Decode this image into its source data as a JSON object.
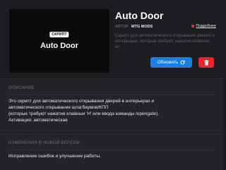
{
  "mod": {
    "title": "Auto Door",
    "thumbnail": {
      "badge": "СКРИПТ",
      "title": "Auto Door"
    },
    "author_label": "АВТОР",
    "author_name": "MTG MODS",
    "more_link": "Подробнее",
    "short_description_lines": [
      "Скрипт для автоматического открывания дверей в",
      "интерьерах, которые требуют нажатия клавиши",
      "ит."
    ],
    "update_button": "Обновить"
  },
  "description": {
    "header": "ОПИСАНИЕ",
    "lines": [
      "Это скрипт для автоматического открывания дверей в интерьерах и",
      "автоматического открывания шлагбаумов/КПП",
      "(которые требуют нажатия клавиши 'H' или ввода команды /opengate).",
      "Активация: автоматическая"
    ]
  },
  "changes": {
    "header": "ИЗМЕНЕНИЯ В НОВОЙ ВЕРСИИ",
    "text": "Исправление ошибок и улучшение работы."
  },
  "colors": {
    "accent_blue": "#1b7ee0",
    "danger_red": "#e8242c"
  },
  "icons": {
    "update": "refresh-icon",
    "delete": "trash-icon"
  }
}
